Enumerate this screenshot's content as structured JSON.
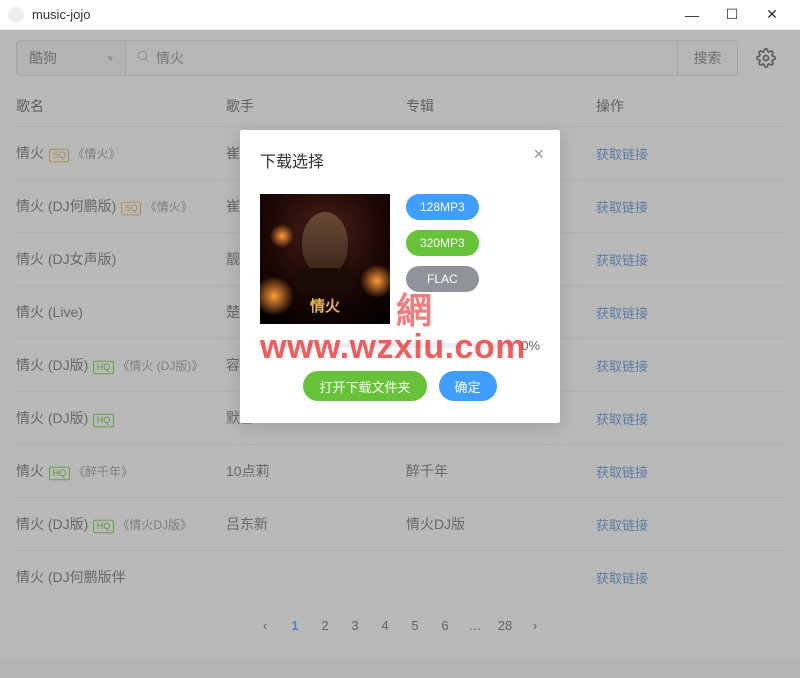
{
  "window": {
    "title": "music-jojo"
  },
  "search": {
    "source": "酷狗",
    "placeholder": "",
    "value": "情火",
    "button": "搜索"
  },
  "columns": {
    "name": "歌名",
    "artist": "歌手",
    "album": "专辑",
    "op": "操作"
  },
  "op_link_label": "获取链接",
  "rows": [
    {
      "name": "情火",
      "quality": "SQ",
      "albumtag": "《情火》",
      "artist": "崔伟立",
      "album": ""
    },
    {
      "name": "情火 (DJ何鹏版)",
      "quality": "SQ",
      "albumtag": "《情火》",
      "artist": "崔伟",
      "album": ""
    },
    {
      "name": "情火 (DJ女声版)",
      "quality": "",
      "albumtag": "",
      "artist": "靓声",
      "album": ""
    },
    {
      "name": "情火 (Live)",
      "quality": "",
      "albumtag": "",
      "artist": "楚少",
      "album": ""
    },
    {
      "name": "情火 (DJ版)",
      "quality": "HQ",
      "albumtag": "《情火 (DJ版)》",
      "artist": "容儿",
      "album": ""
    },
    {
      "name": "情火 (DJ版)",
      "quality": "HQ",
      "albumtag": "",
      "artist": "默言",
      "album": ""
    },
    {
      "name": "情火",
      "quality": "HQ",
      "albumtag": "《醉千年》",
      "artist": "10点莉",
      "album": "醉千年"
    },
    {
      "name": "情火 (DJ版)",
      "quality": "HQ",
      "albumtag": "《情火DJ版》",
      "artist": "吕东新",
      "album": "情火DJ版"
    },
    {
      "name": "情火 (DJ何鹏版伴",
      "quality": "",
      "albumtag": "",
      "artist": "",
      "album": ""
    }
  ],
  "pagination": {
    "pages": [
      "1",
      "2",
      "3",
      "4",
      "5",
      "6",
      "…",
      "28"
    ],
    "active": "1"
  },
  "modal": {
    "title": "下载选择",
    "cover_title": "情火",
    "qualities": [
      {
        "label": "128MP3",
        "style": "blue"
      },
      {
        "label": "320MP3",
        "style": "green"
      },
      {
        "label": "FLAC",
        "style": "grey"
      }
    ],
    "progress": "0%",
    "open_folder": "打开下载文件夹",
    "confirm": "确定"
  },
  "watermark": "www.wzxiu.com",
  "wmtop": "網"
}
